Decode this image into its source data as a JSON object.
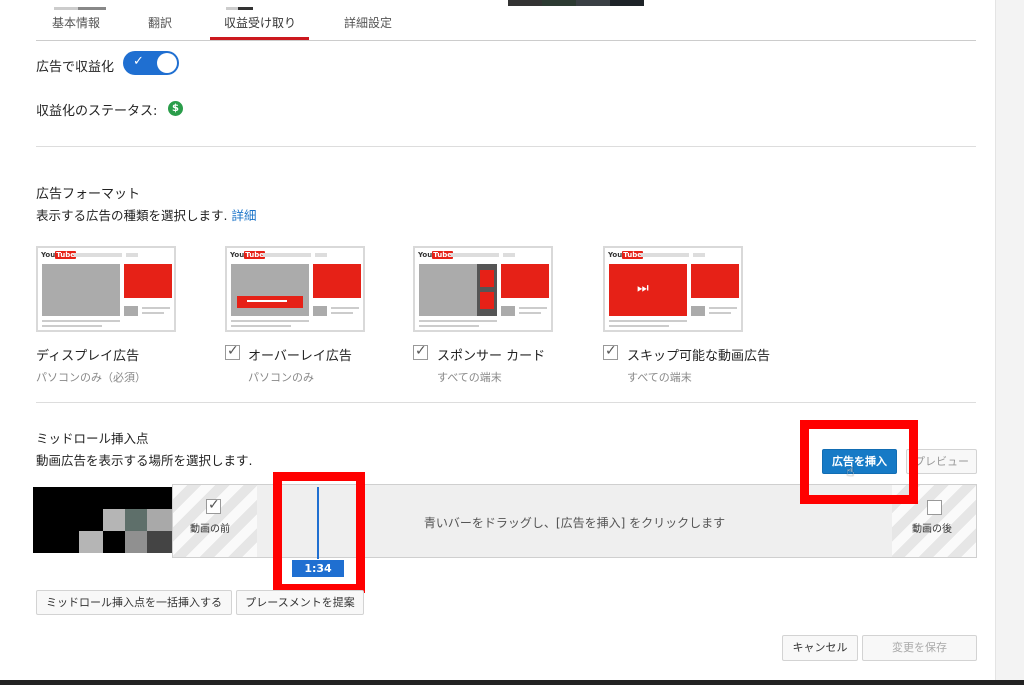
{
  "tabs": [
    {
      "label": "基本情報"
    },
    {
      "label": "翻訳"
    },
    {
      "label": "収益受け取り"
    },
    {
      "label": "詳細設定"
    }
  ],
  "monetize": {
    "label": "広告で収益化",
    "status_label": "収益化のステータス:",
    "status_icon": "$"
  },
  "ad_format": {
    "title": "広告フォーマット",
    "description": "表示する広告の種類を選択します.",
    "link": "詳細",
    "logo_text": "You",
    "logo_tube": "Tube",
    "skip_glyph": "⏭",
    "check_glyph": "✓",
    "options": [
      {
        "label": "ディスプレイ広告",
        "sub": "パソコンのみ（必須）"
      },
      {
        "label": "オーバーレイ広告",
        "sub": "パソコンのみ"
      },
      {
        "label": "スポンサー カード",
        "sub": "すべての端末"
      },
      {
        "label": "スキップ可能な動画広告",
        "sub": "すべての端末"
      }
    ]
  },
  "midroll": {
    "title": "ミッドロール挿入点",
    "description": "動画広告を表示する場所を選択します.",
    "insert_button": "広告を挿入",
    "preview_button": "プレビュー",
    "before_label": "動画の前",
    "after_label": "動画の後",
    "instruction": "青いバーをドラッグし、[広告を挿入] をクリックします",
    "time": "1:34",
    "bulk_button": "ミッドロール挿入点を一括挿入する",
    "suggest_button": "プレースメントを提案",
    "cursor_glyph": "☝"
  },
  "footer": {
    "cancel": "キャンセル",
    "save": "変更を保存"
  },
  "colors": {
    "accent": "#167ac6",
    "red": "#e62117",
    "highlight": "#ff0000"
  }
}
